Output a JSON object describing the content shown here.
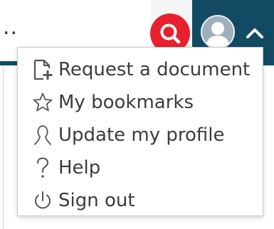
{
  "header": {
    "search_text": "..",
    "search_button_icon": "search-icon",
    "avatar_icon": "user-avatar-icon",
    "caret_icon": "chevron-up-icon",
    "colors": {
      "search_button": "#e8212e",
      "header_dark": "#134a63",
      "header_line": "#0c4d6e"
    }
  },
  "menu": {
    "items": [
      {
        "label": "Request a document",
        "icon": "document-add-icon"
      },
      {
        "label": "My bookmarks",
        "icon": "star-icon"
      },
      {
        "label": "Update my profile",
        "icon": "profile-icon"
      },
      {
        "label": "Help",
        "icon": "question-icon"
      },
      {
        "label": "Sign out",
        "icon": "power-icon"
      }
    ]
  }
}
